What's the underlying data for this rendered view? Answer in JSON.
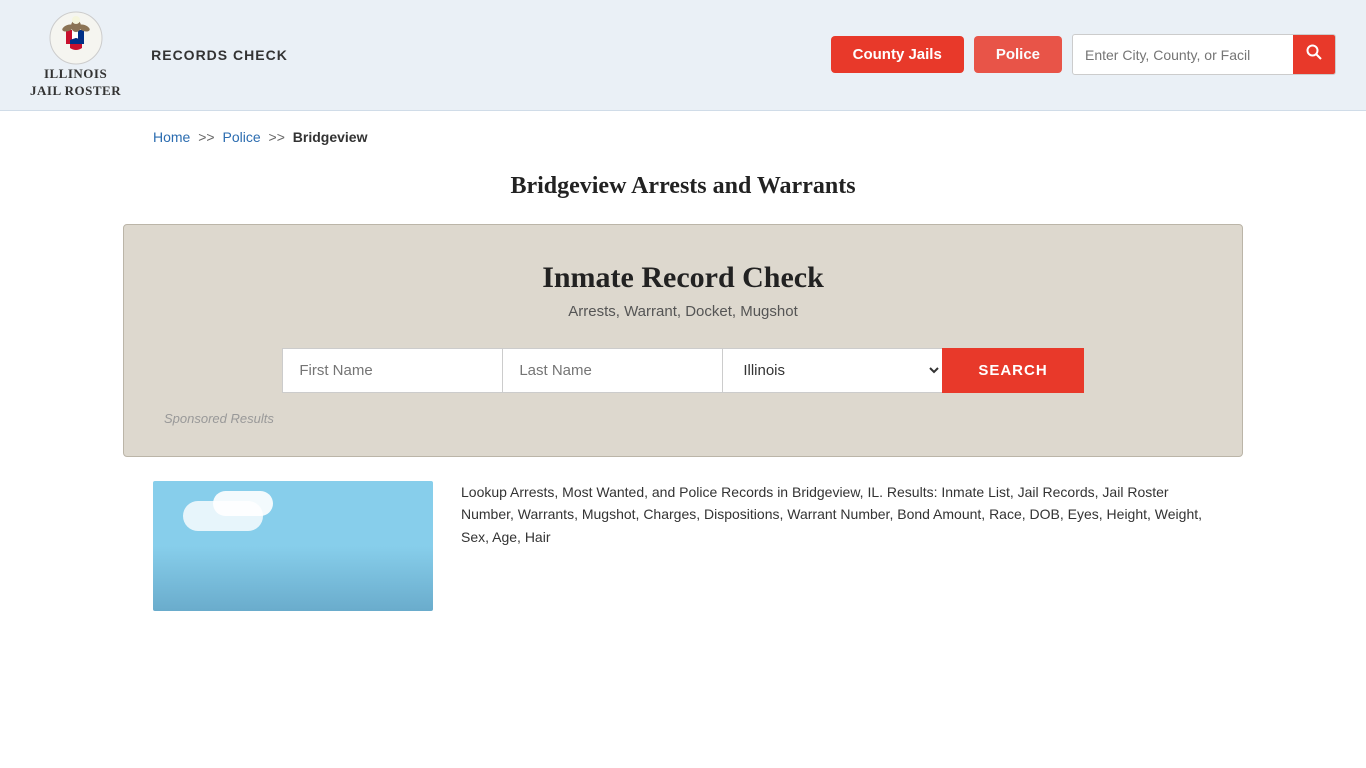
{
  "header": {
    "logo_line1": "ILLINOIS",
    "logo_line2": "JAIL ROSTER",
    "records_check_label": "RECORDS CHECK",
    "nav": {
      "county_jails_label": "County Jails",
      "police_label": "Police"
    },
    "search_placeholder": "Enter City, County, or Facil"
  },
  "breadcrumb": {
    "home_label": "Home",
    "sep1": ">>",
    "police_label": "Police",
    "sep2": ">>",
    "current_label": "Bridgeview"
  },
  "page_title": "Bridgeview Arrests and Warrants",
  "inmate_search": {
    "title": "Inmate Record Check",
    "subtitle": "Arrests, Warrant, Docket, Mugshot",
    "first_name_placeholder": "First Name",
    "last_name_placeholder": "Last Name",
    "state_default": "Illinois",
    "search_button_label": "SEARCH",
    "sponsored_label": "Sponsored Results"
  },
  "description": {
    "text": "Lookup Arrests, Most Wanted, and Police Records in Bridgeview, IL. Results: Inmate List, Jail Records, Jail Roster Number, Warrants, Mugshot, Charges, Dispositions, Warrant Number, Bond Amount, Race, DOB, Eyes, Height, Weight, Sex, Age, Hair"
  },
  "colors": {
    "accent_red": "#e8392a",
    "link_blue": "#2b6cb0",
    "bg_header": "#eaf0f6",
    "bg_search": "#ddd8ce"
  }
}
